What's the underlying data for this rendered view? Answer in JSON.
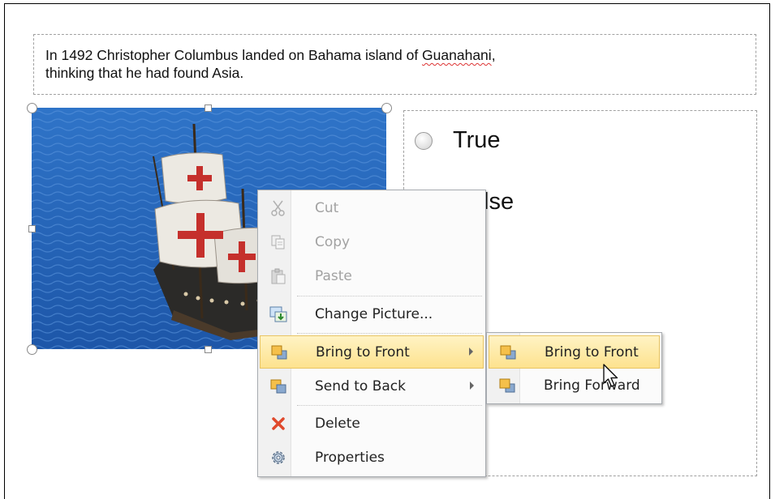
{
  "question": {
    "text_before": "In 1492 Christopher Columbus landed on Bahama island of ",
    "misspelled_word": "Guanahani",
    "text_after": ",",
    "line2": "thinking that he had found Asia."
  },
  "answers": {
    "true_label": "True",
    "false_label_partial": "lse"
  },
  "picture": {
    "description_icon": "ship-image"
  },
  "context_menu": {
    "cut": "Cut",
    "copy": "Copy",
    "paste": "Paste",
    "change_picture": "Change Picture...",
    "bring_to_front": "Bring to Front",
    "send_to_back": "Send to Back",
    "delete": "Delete",
    "properties": "Properties"
  },
  "submenu": {
    "bring_to_front": "Bring to Front",
    "bring_forward": "Bring Forward"
  },
  "colors": {
    "highlight_top": "#fff3c4",
    "highlight_bottom": "#fde28e",
    "highlight_border": "#e8c462"
  }
}
